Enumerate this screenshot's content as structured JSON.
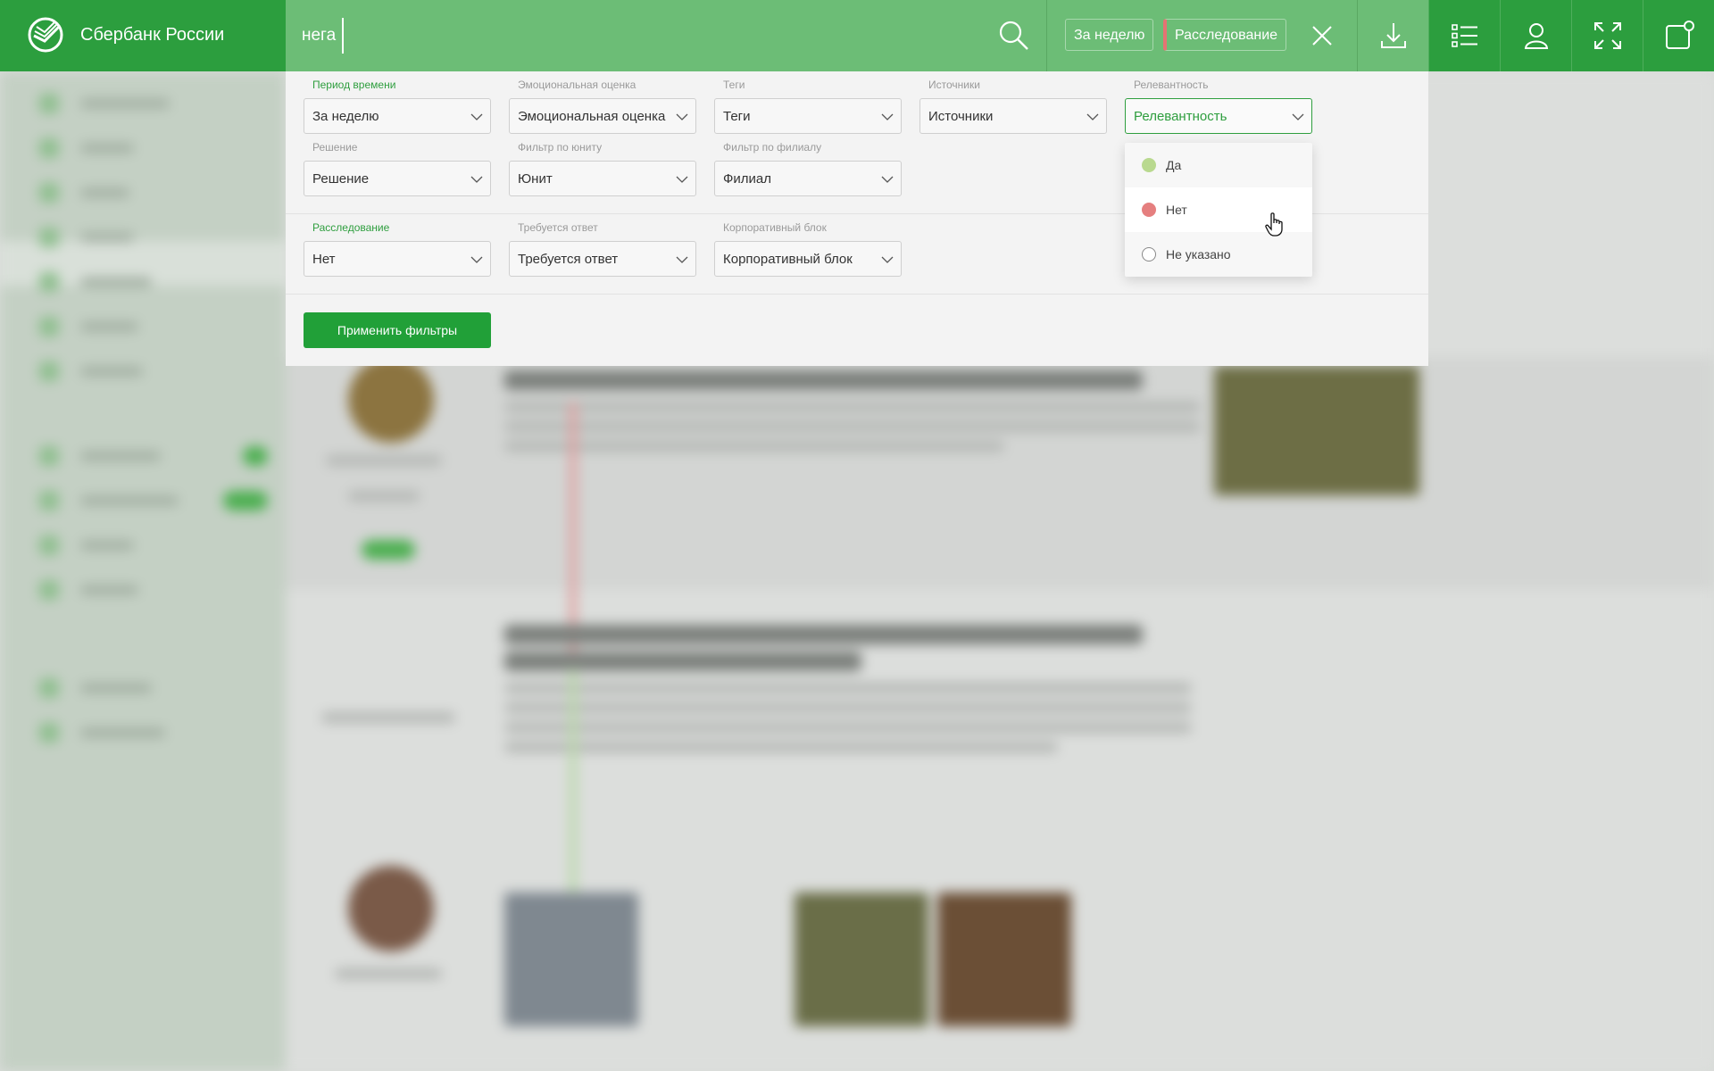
{
  "header": {
    "brand": "Сбербанк России",
    "search": {
      "value": "нега",
      "placeholder": ""
    },
    "chips": [
      {
        "label": "За неделю"
      },
      {
        "label": "Расследование"
      }
    ],
    "buttons": [
      "download-icon",
      "list-view-icon",
      "user-icon",
      "fullscreen-icon",
      "notifications-icon"
    ]
  },
  "filters": {
    "row1": [
      {
        "label": "Период времени",
        "value": "За неделю",
        "active_label": true
      },
      {
        "label": "Эмоциональная оценка",
        "value": "Эмоциональная оценка"
      },
      {
        "label": "Теги",
        "value": "Теги"
      },
      {
        "label": "Источники",
        "value": "Источники"
      },
      {
        "label": "Релевантность",
        "value": "Релевантность",
        "open": true
      }
    ],
    "row2": [
      {
        "label": "Решение",
        "value": "Решение"
      },
      {
        "label": "Фильтр по юниту",
        "value": "Юнит"
      },
      {
        "label": "Фильтр по филиалу",
        "value": "Филиал"
      }
    ],
    "row3": [
      {
        "label": "Расследование",
        "value": "Нет",
        "active_label": true
      },
      {
        "label": "Требуется ответ",
        "value": "Требуется ответ"
      },
      {
        "label": "Корпоративный блок",
        "value": "Корпоративный блок"
      }
    ],
    "apply_label": "Применить фильтры"
  },
  "relevance_dropdown": {
    "options": [
      {
        "label": "Да",
        "color": "#b9d98f"
      },
      {
        "label": "Нет",
        "color": "#e57f7f",
        "hovered": true
      },
      {
        "label": "Не указано",
        "color": "none"
      }
    ]
  },
  "colors": {
    "brand": "#2c9e3e",
    "header_light": "#6cbd76",
    "accent_green": "#21a038",
    "invest_marker": "#e57373"
  }
}
